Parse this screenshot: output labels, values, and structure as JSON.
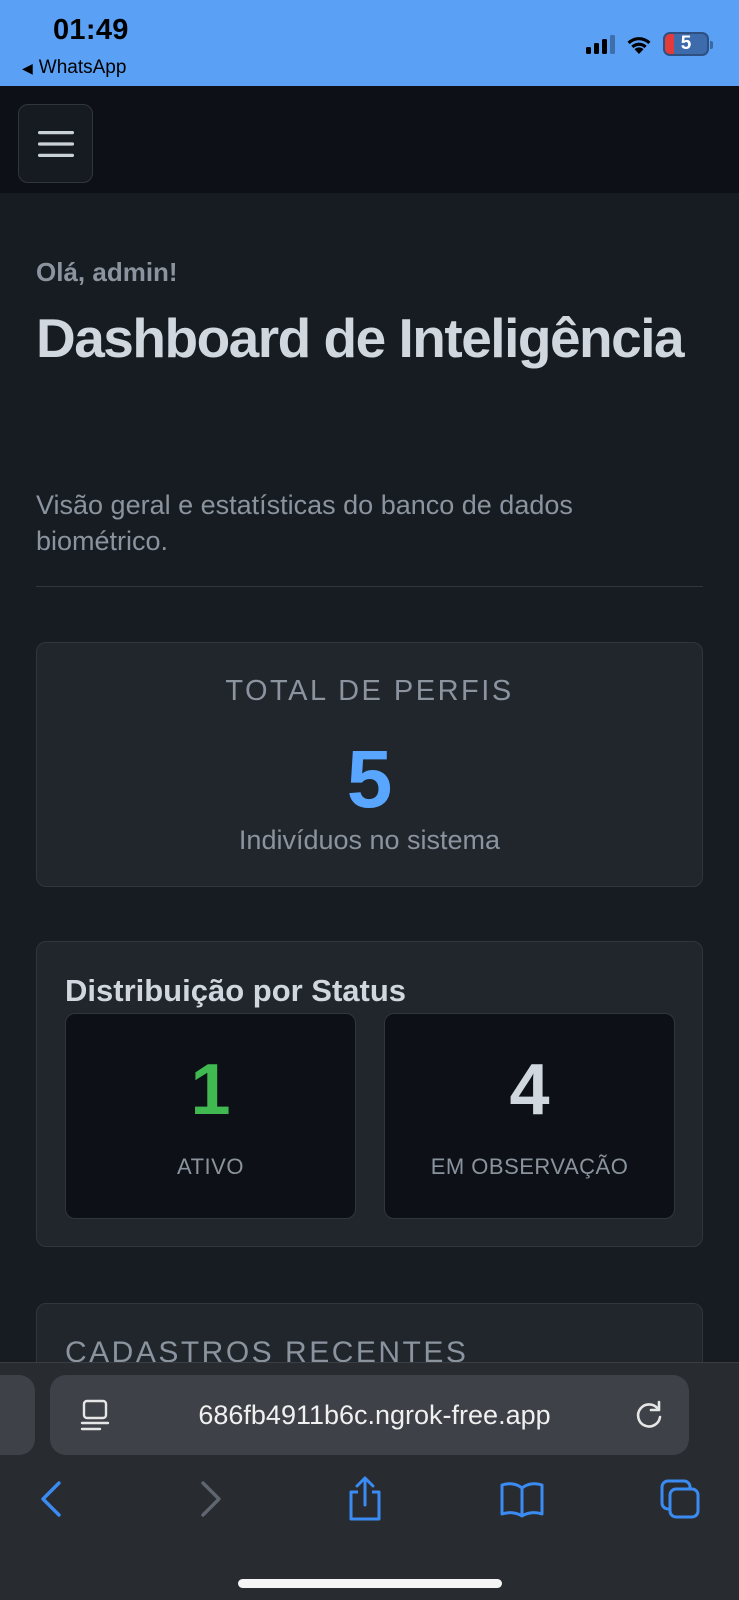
{
  "status_bar": {
    "time": "01:49",
    "back_app": "WhatsApp",
    "battery_level": "5"
  },
  "navbar": {
    "menu_icon": "hamburger-menu-icon"
  },
  "header": {
    "greeting": "Olá, admin!",
    "title": "Dashboard de Inteligência",
    "subtitle": "Visão geral e estatísticas do banco de dados biométrico."
  },
  "total_card": {
    "label": "TOTAL DE PERFIS",
    "value": "5",
    "caption": "Indivíduos no sistema"
  },
  "status_card": {
    "title": "Distribuição por Status",
    "items": [
      {
        "value": "1",
        "label": "ATIVO",
        "color": "#3fb950"
      },
      {
        "value": "4",
        "label": "EM OBSERVAÇÃO",
        "color": "#d0d7de"
      }
    ]
  },
  "recent_card": {
    "title": "CADASTROS RECENTES"
  },
  "browser": {
    "url": "686fb4911b6c.ngrok-free.app",
    "toolbar_icons": [
      "back-icon",
      "forward-icon",
      "share-icon",
      "bookmarks-icon",
      "tabs-icon"
    ]
  },
  "colors": {
    "accent": "#58a6ff",
    "status_bar": "#5aa0f5",
    "background": "#171b22",
    "card": "#21262d"
  }
}
